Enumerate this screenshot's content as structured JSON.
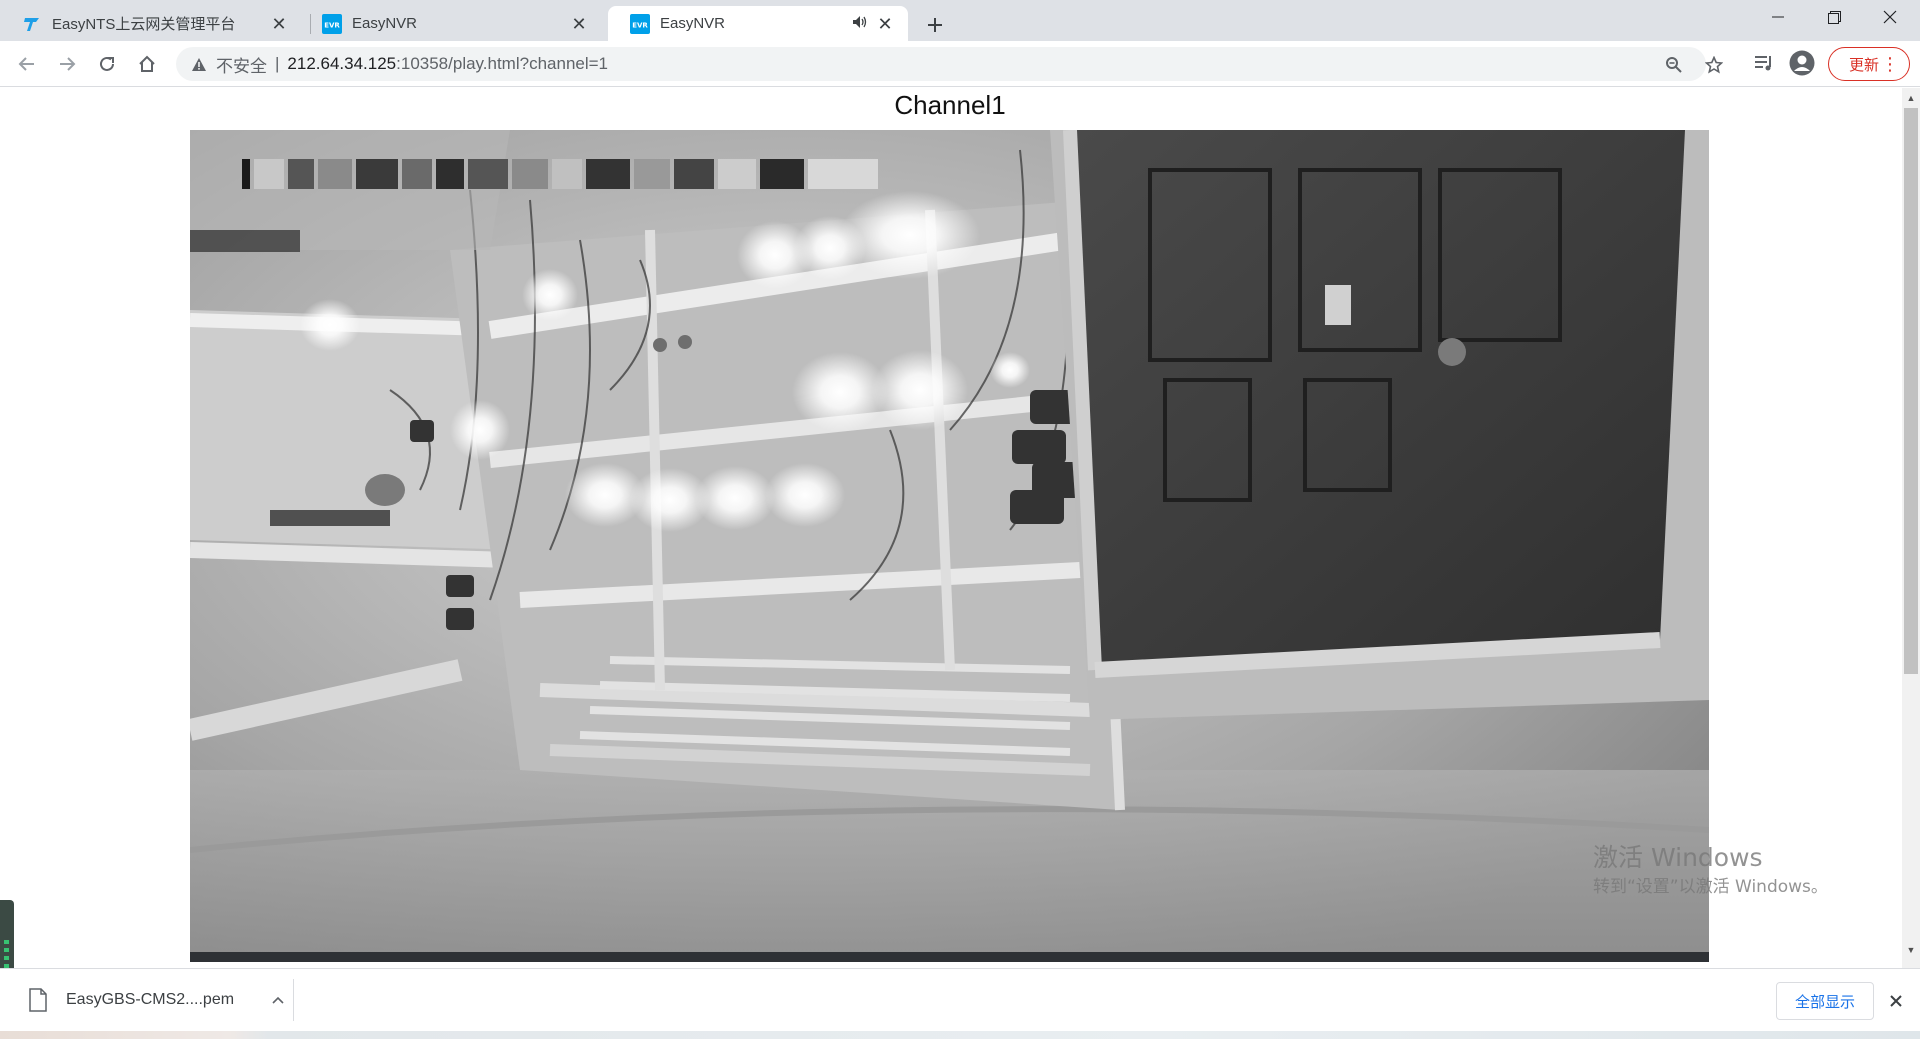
{
  "browser": {
    "tabs": [
      {
        "title": "EasyNTS上云网关管理平台",
        "favicon": "easynts-logo-icon",
        "active": false
      },
      {
        "title": "EasyNVR",
        "favicon": "easynvr-logo-icon",
        "active": false
      },
      {
        "title": "EasyNVR",
        "favicon": "easynvr-logo-icon",
        "active": true,
        "audio": true
      }
    ],
    "address": {
      "security_label": "不安全",
      "separator": "|",
      "host": "212.64.34.125",
      "path": ":10358/play.html?channel=1"
    },
    "update_label": "更新"
  },
  "page": {
    "title": "Channel1"
  },
  "system": {
    "watermark_line1": "激活 Windows",
    "watermark_line2": "转到“设置”以激活 Windows。"
  },
  "downloads": {
    "file_name": "EasyGBS-CMS2....pem",
    "show_all_label": "全部显示"
  },
  "colors": {
    "tabstrip_bg": "#dee1e6",
    "accent_blue": "#1a73e8",
    "update_red": "#d93025",
    "easynvr_brand": "#00a0e9"
  }
}
